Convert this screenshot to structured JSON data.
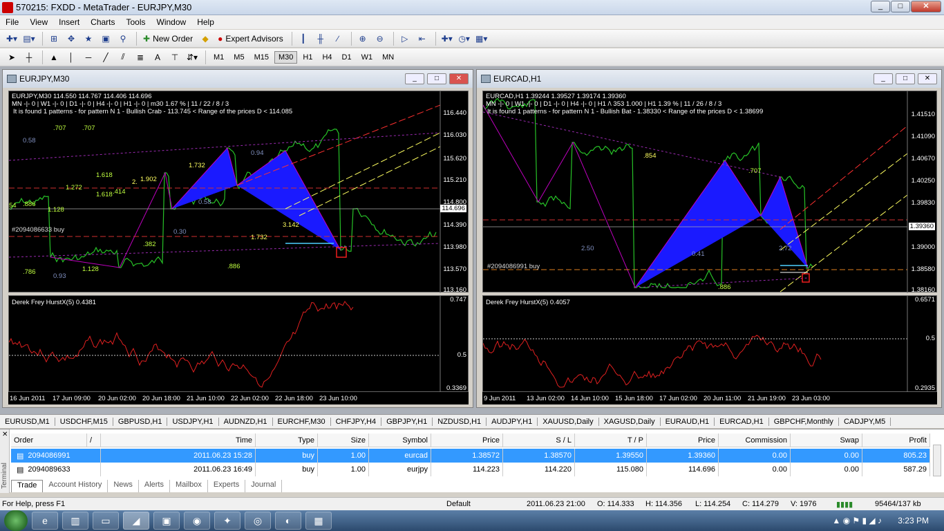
{
  "window": {
    "title": "570215: FXDD - MetaTrader - EURJPY,M30"
  },
  "menu": [
    "File",
    "View",
    "Insert",
    "Charts",
    "Tools",
    "Window",
    "Help"
  ],
  "toolbar": {
    "new_order": "New Order",
    "expert_advisors": "Expert Advisors"
  },
  "timeframes": [
    "M1",
    "M5",
    "M15",
    "M30",
    "H1",
    "H4",
    "D1",
    "W1",
    "MN"
  ],
  "active_timeframe": "M30",
  "chart1": {
    "title": "EURJPY,M30",
    "info1": "EURJPY,M30  114.550 114.767 114.406 114.696",
    "info2": "MN -|- 0 |  W1 -|- 0 |  D1 -|- 0 |  H4 -|- 0 |  H1 -|- 0 |  m30  1.67 %  |  11 / 22 / 8 / 3",
    "info3": "It is found 1 patterns  -  for pattern N 1 - Bullish Crab - 113.745 < Range of the prices D < 114.085",
    "order_label": "#2094086633 buy",
    "price_scale": [
      "116.440",
      "116.030",
      "115.620",
      "115.210",
      "114.800",
      "114.390",
      "113.980",
      "113.570",
      "113.160"
    ],
    "current_price": "114.696",
    "fib_labels": [
      ".707",
      ".707",
      "0.58",
      "1.618",
      "1.618",
      ".414",
      "1.272",
      "1.902",
      "2.",
      "1.732",
      "0.94",
      "0.58",
      "1.128",
      ".886",
      "54",
      "0.30",
      "3.142",
      "1.732",
      ".382",
      "1.128",
      ".886",
      ".786",
      "0.93"
    ],
    "indicator": {
      "title": "Derek Frey HurstX(5) 0.4381",
      "scale": [
        "0.747",
        "0.5",
        "0.3369"
      ]
    },
    "time_axis": [
      "16 Jun 2011",
      "17 Jun 09:00",
      "20 Jun 02:00",
      "20 Jun 18:00",
      "21 Jun 10:00",
      "22 Jun 02:00",
      "22 Jun 18:00",
      "23 Jun 10:00"
    ]
  },
  "chart2": {
    "title": "EURCAD,H1",
    "info1": "EURCAD,H1  1.39244 1.39527 1.39174 1.39360",
    "info2": "MN -|- 0 |  W1 -|- 0 |  D1 -|- 0 |  H4 -|- 0 |  H1 /\\ 353   1.000 |  H1  1.39 %  |  11 / 26 / 8 / 3",
    "info3": "It is found 1 patterns  -  for pattern N 1 - Bullish Bat - 1.38330 < Range of the prices D < 1.38699",
    "order_label": "#2094086991 buy",
    "price_scale": [
      "1.41510",
      "1.41090",
      "1.40670",
      "1.40250",
      "1.39830",
      "1.39360",
      "1.39000",
      "1.38580",
      "1.38160"
    ],
    "current_price": "1.39360",
    "fib_labels": [
      ".854",
      ".707",
      "2.50",
      "0.41",
      "2.72",
      ".886"
    ],
    "indicator": {
      "title": "Derek Frey HurstX(5) 0.4057",
      "scale": [
        "0.6571",
        "0.5",
        "0.2935"
      ]
    },
    "time_axis": [
      "9 Jun 2011",
      "13 Jun 02:00",
      "14 Jun 10:00",
      "15 Jun 18:00",
      "17 Jun 02:00",
      "20 Jun 11:00",
      "21 Jun 19:00",
      "23 Jun 03:00"
    ]
  },
  "symbol_tabs": [
    "EURUSD,M1",
    "USDCHF,M15",
    "GBPUSD,H1",
    "USDJPY,H1",
    "AUDNZD,H1",
    "EURCHF,M30",
    "CHFJPY,H4",
    "GBPJPY,H1",
    "NZDUSD,H1",
    "AUDJPY,H1",
    "XAUUSD,Daily",
    "XAGUSD,Daily",
    "EURAUD,H1",
    "EURCAD,H1",
    "GBPCHF,Monthly",
    "CADJPY,M5"
  ],
  "terminal": {
    "side_label": "Terminal",
    "columns": [
      "Order",
      "/",
      "Time",
      "Type",
      "Size",
      "Symbol",
      "Price",
      "S / L",
      "T / P",
      "Price",
      "Commission",
      "Swap",
      "Profit"
    ],
    "rows": [
      {
        "order": "2094086991",
        "time": "2011.06.23 15:28",
        "type": "buy",
        "size": "1.00",
        "symbol": "eurcad",
        "price": "1.38572",
        "sl": "1.38570",
        "tp": "1.39550",
        "cur": "1.39360",
        "commission": "0.00",
        "swap": "0.00",
        "profit": "805.23"
      },
      {
        "order": "2094089633",
        "time": "2011.06.23 16:49",
        "type": "buy",
        "size": "1.00",
        "symbol": "eurjpy",
        "price": "114.223",
        "sl": "114.220",
        "tp": "115.080",
        "cur": "114.696",
        "commission": "0.00",
        "swap": "0.00",
        "profit": "587.29"
      }
    ],
    "tabs": [
      "Trade",
      "Account History",
      "News",
      "Alerts",
      "Mailbox",
      "Experts",
      "Journal"
    ]
  },
  "status": {
    "help": "For Help, press F1",
    "profile": "Default",
    "datetime": "2011.06.23 21:00",
    "open": "O: 114.333",
    "high": "H: 114.356",
    "low": "L: 114.254",
    "close": "C: 114.279",
    "volume": "V: 1976",
    "traffic": "95464/137 kb"
  },
  "clock": "3:23 PM"
}
